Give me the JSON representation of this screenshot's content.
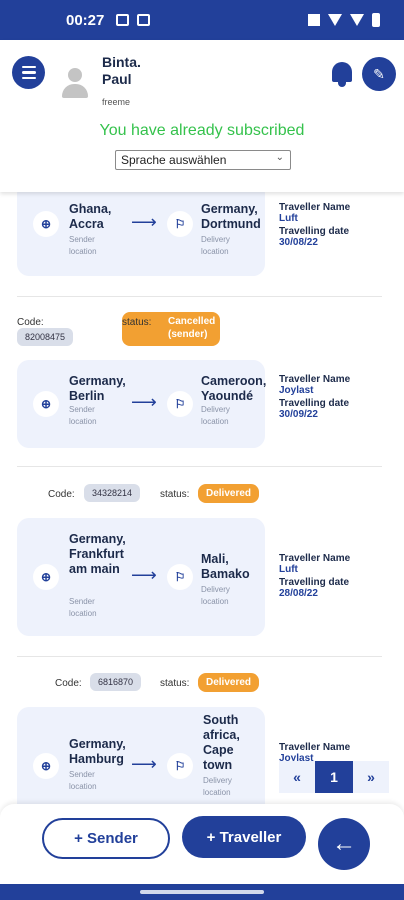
{
  "status_bar": {
    "time": "00:27"
  },
  "header": {
    "user_name": "Binta. Paul",
    "user_plan": "freeme",
    "subscription_message": "You have already subscribed",
    "language_select": "Sprache auswählen"
  },
  "trips": [
    {
      "sender": "Ghana, Accra",
      "sender_label": "Sender location",
      "delivery": "Germany, Dortmund",
      "delivery_label": "Delivery location",
      "traveller_label": "Traveller Name",
      "traveller": "Luft",
      "date_label": "Travelling date",
      "date": "30/08/22"
    },
    {
      "code_label": "Code:",
      "code": "82008475",
      "status_label": "status:",
      "status": "Cancelled (sender)",
      "sender": "Germany, Berlin",
      "sender_label": "Sender location",
      "delivery": "Cameroon, Yaoundé",
      "delivery_label": "Delivery location",
      "traveller_label": "Traveller Name",
      "traveller": "Joylast",
      "date_label": "Travelling date",
      "date": "30/09/22"
    },
    {
      "code_label": "Code:",
      "code": "34328214",
      "status_label": "status:",
      "status": "Delivered",
      "sender": "Germany, Frankfurt am main",
      "sender_label": "Sender location",
      "delivery": "Mali, Bamako",
      "delivery_label": "Delivery location",
      "traveller_label": "Traveller Name",
      "traveller": "Luft",
      "date_label": "Travelling date",
      "date": "28/08/22"
    },
    {
      "code_label": "Code:",
      "code": "6816870",
      "status_label": "status:",
      "status": "Delivered",
      "sender": "Germany, Hamburg",
      "sender_label": "Sender location",
      "delivery": "South africa, Cape town",
      "delivery_label": "Delivery location",
      "traveller_label": "Traveller Name",
      "traveller": "Joylast"
    }
  ],
  "pagination": {
    "prev": "«",
    "current": "1",
    "next": "»"
  },
  "actions": {
    "sender": "+ Sender",
    "traveller": "+ Traveller",
    "back": "←"
  },
  "colors": {
    "primary": "#22409a",
    "success": "#35c24c",
    "status_orange": "#f2a032",
    "card_bg": "#eef2fc"
  }
}
